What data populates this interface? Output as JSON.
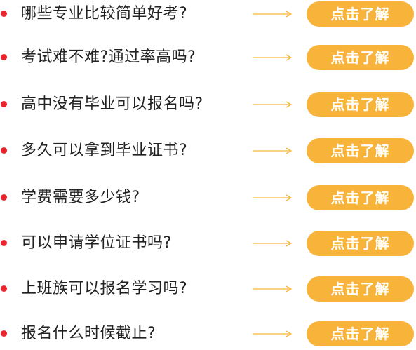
{
  "faq": {
    "items": [
      {
        "question": "哪些专业比较简单好考?",
        "button_label": "点击了解"
      },
      {
        "question": "考试难不难?通过率高吗?",
        "button_label": "点击了解"
      },
      {
        "question": "高中没有毕业可以报名吗?",
        "button_label": "点击了解"
      },
      {
        "question": "多久可以拿到毕业证书?",
        "button_label": "点击了解"
      },
      {
        "question": "学费需要多少钱?",
        "button_label": "点击了解"
      },
      {
        "question": "可以申请学位证书吗?",
        "button_label": "点击了解"
      },
      {
        "question": "上班族可以报名学习吗?",
        "button_label": "点击了解"
      },
      {
        "question": "报名什么时候截止?",
        "button_label": "点击了解"
      }
    ]
  },
  "icons": {
    "bullet": "red-dot-icon",
    "arrow": "arrow-right-icon"
  },
  "colors": {
    "bullet": "#e8242d",
    "arrow": "#f5b63c",
    "button_bg": "#f8b33a",
    "button_text": "#ffffff",
    "question_text": "#222222"
  }
}
